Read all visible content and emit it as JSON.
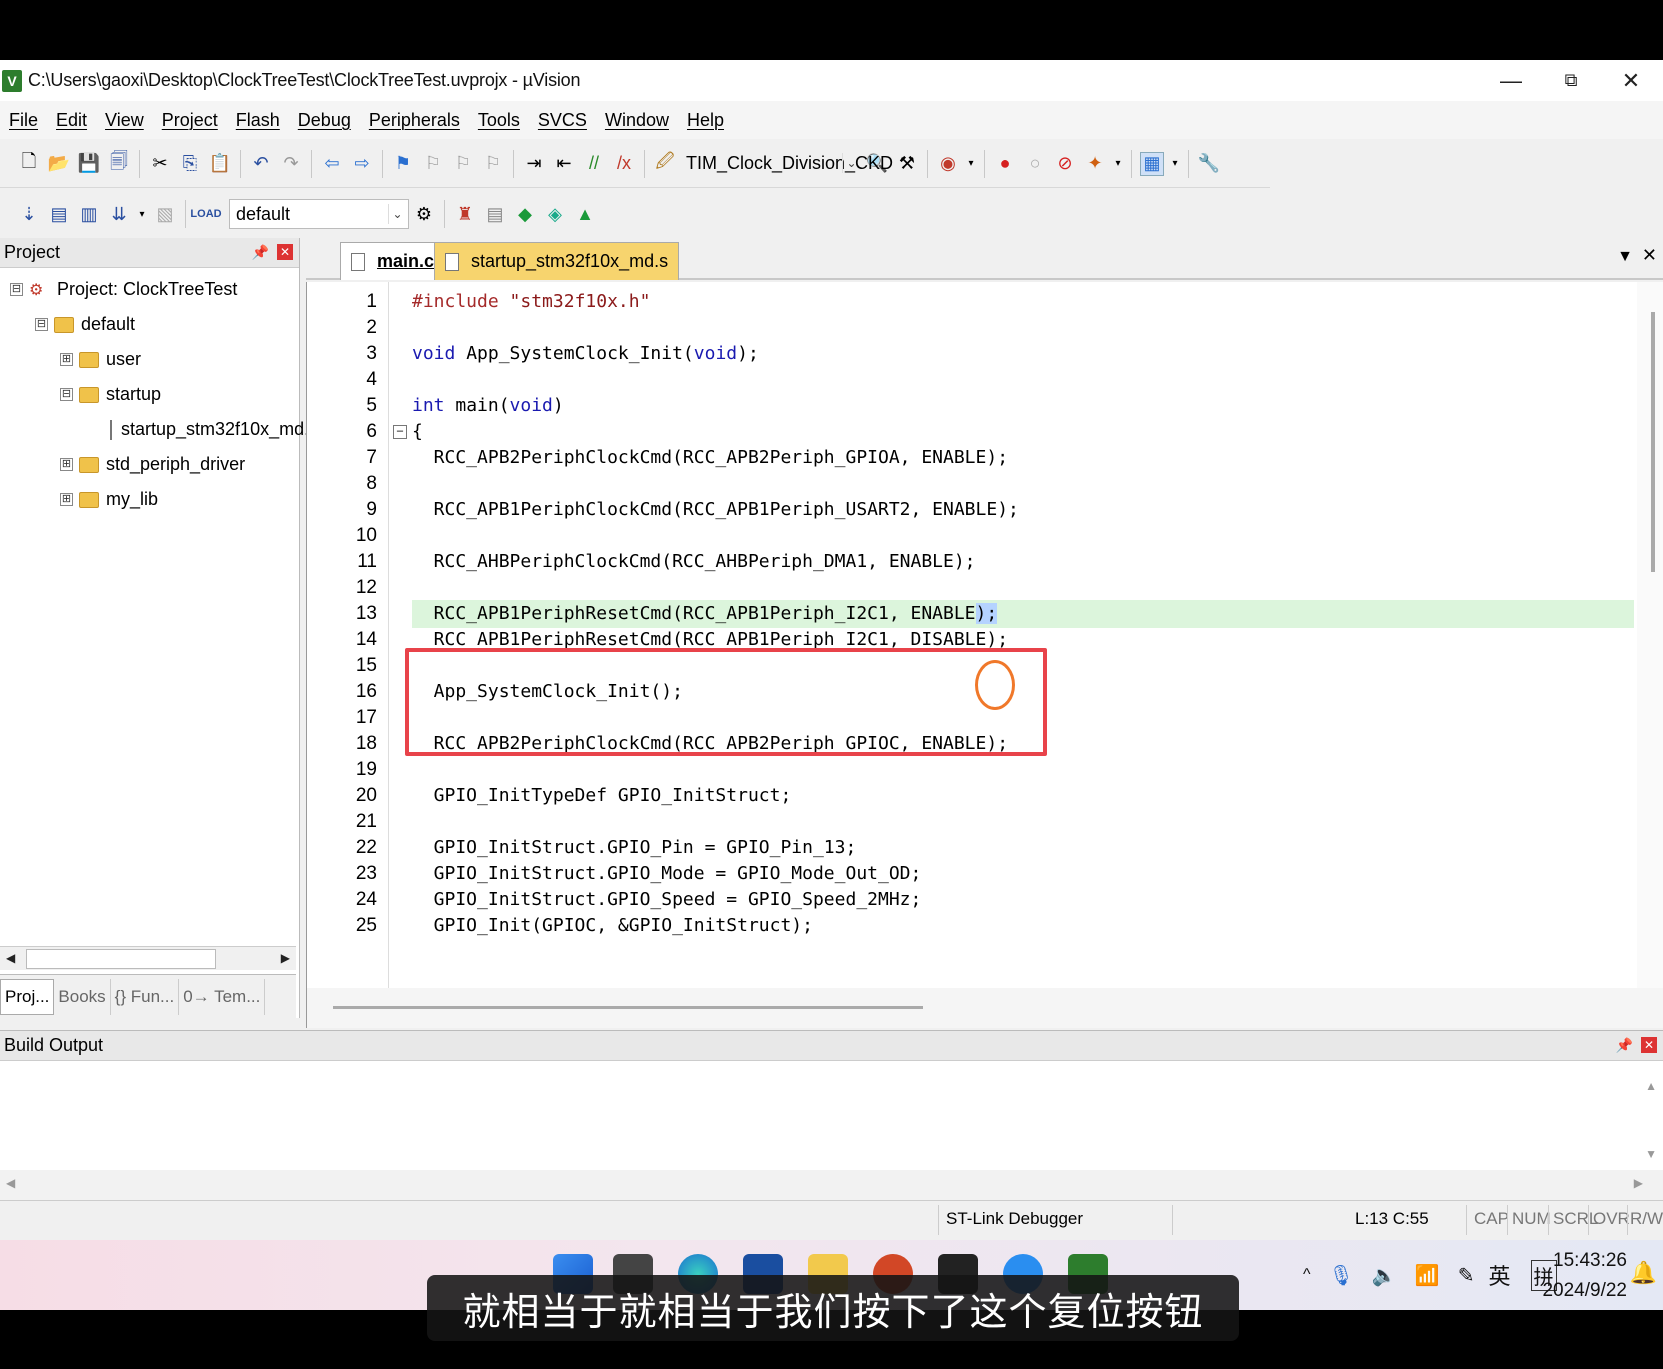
{
  "window": {
    "title": "C:\\Users\\gaoxi\\Desktop\\ClockTreeTest\\ClockTreeTest.uvprojx - µVision",
    "minimize": "—",
    "maximize": "⧉",
    "close": "✕"
  },
  "menu": [
    "File",
    "Edit",
    "View",
    "Project",
    "Flash",
    "Debug",
    "Peripherals",
    "Tools",
    "SVCS",
    "Window",
    "Help"
  ],
  "toolbar": {
    "target_combo": "TIM_Clock_Division_CKD",
    "build_target": "default"
  },
  "project_panel": {
    "title": "Project",
    "tree": [
      {
        "label": "Project: ClockTreeTest",
        "expander": "⊟"
      },
      {
        "label": "default",
        "expander": "⊟"
      },
      {
        "label": "user",
        "expander": "⊞"
      },
      {
        "label": "startup",
        "expander": "⊟"
      },
      {
        "label": "startup_stm32f10x_md.",
        "expander": ""
      },
      {
        "label": "std_periph_driver",
        "expander": "⊞"
      },
      {
        "label": "my_lib",
        "expander": "⊞"
      }
    ],
    "tabs": [
      "Proj...",
      "Books",
      "{} Fun...",
      "0→ Tem..."
    ]
  },
  "editor": {
    "tabs": [
      "main.c",
      "startup_stm32f10x_md.s"
    ],
    "current_line": 13,
    "lines": [
      {
        "n": "1",
        "code": "#include \"stm32f10x.h\""
      },
      {
        "n": "2",
        "code": ""
      },
      {
        "n": "3",
        "code": "void App_SystemClock_Init(void);"
      },
      {
        "n": "4",
        "code": ""
      },
      {
        "n": "5",
        "code": "int main(void)"
      },
      {
        "n": "6",
        "code": "{"
      },
      {
        "n": "7",
        "code": "  RCC_APB2PeriphClockCmd(RCC_APB2Periph_GPIOA, ENABLE);"
      },
      {
        "n": "8",
        "code": ""
      },
      {
        "n": "9",
        "code": "  RCC_APB1PeriphClockCmd(RCC_APB1Periph_USART2, ENABLE);"
      },
      {
        "n": "10",
        "code": ""
      },
      {
        "n": "11",
        "code": "  RCC_AHBPeriphClockCmd(RCC_AHBPeriph_DMA1, ENABLE);"
      },
      {
        "n": "12",
        "code": ""
      },
      {
        "n": "13",
        "code": "  RCC_APB1PeriphResetCmd(RCC_APB1Periph_I2C1, ENABLE);"
      },
      {
        "n": "14",
        "code": "  RCC_APB1PeriphResetCmd(RCC_APB1Periph_I2C1, DISABLE);"
      },
      {
        "n": "15",
        "code": ""
      },
      {
        "n": "16",
        "code": "  App_SystemClock_Init();"
      },
      {
        "n": "17",
        "code": ""
      },
      {
        "n": "18",
        "code": "  RCC_APB2PeriphClockCmd(RCC_APB2Periph_GPIOC, ENABLE);"
      },
      {
        "n": "19",
        "code": ""
      },
      {
        "n": "20",
        "code": "  GPIO_InitTypeDef GPIO_InitStruct;"
      },
      {
        "n": "21",
        "code": ""
      },
      {
        "n": "22",
        "code": "  GPIO_InitStruct.GPIO_Pin = GPIO_Pin_13;"
      },
      {
        "n": "23",
        "code": "  GPIO_InitStruct.GPIO_Mode = GPIO_Mode_Out_OD;"
      },
      {
        "n": "24",
        "code": "  GPIO_InitStruct.GPIO_Speed = GPIO_Speed_2MHz;"
      },
      {
        "n": "25",
        "code": "  GPIO_Init(GPIOC, &GPIO_InitStruct);"
      }
    ]
  },
  "build_output": {
    "title": "Build Output"
  },
  "status": {
    "debugger": "ST-Link Debugger",
    "position": "L:13 C:55",
    "cap": "CAP",
    "num": "NUM",
    "scrl": "SCRL",
    "ovr": "OVR",
    "rw": "R/W"
  },
  "taskbar": {
    "time": "15:43:26",
    "date": "2024/9/22",
    "ime_lang": "英",
    "ime_mode": "拼"
  },
  "subtitle": "就相当于就相当于我们按下了这个复位按钮",
  "colors": {
    "highlight_box": "#e8434a",
    "cursor_circle": "#f0782a",
    "current_line_bg": "#dcf5dc"
  }
}
